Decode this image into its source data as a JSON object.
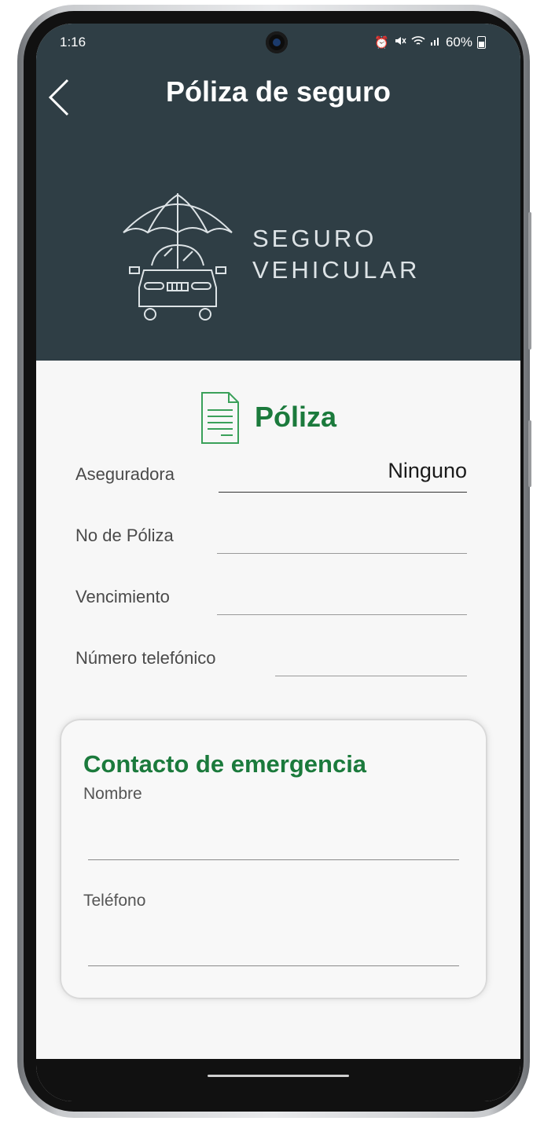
{
  "status_bar": {
    "time": "1:16",
    "battery": "60%",
    "icons": [
      "alarm-icon",
      "mute-icon",
      "wifi-icon",
      "signal-icon",
      "battery-icon"
    ]
  },
  "header": {
    "title": "Póliza de seguro",
    "back_icon": "chevron-left-icon",
    "background": "#2f3e45",
    "logo": {
      "icon": "car-umbrella-icon",
      "line1": "SEGURO",
      "line2": "VEHICULAR"
    }
  },
  "policy": {
    "section_icon": "document-icon",
    "section_title": "Póliza",
    "accent": "#1b7a3c",
    "fields": [
      {
        "label": "Aseguradora",
        "value": "Ninguno"
      },
      {
        "label": "No de Póliza",
        "value": ""
      },
      {
        "label": "Vencimiento",
        "value": ""
      },
      {
        "label": "Número telefónico",
        "value": ""
      }
    ]
  },
  "emergency": {
    "title": "Contacto de emergencia",
    "name_label": "Nombre",
    "name_value": "",
    "phone_label": "Teléfono",
    "phone_value": ""
  }
}
